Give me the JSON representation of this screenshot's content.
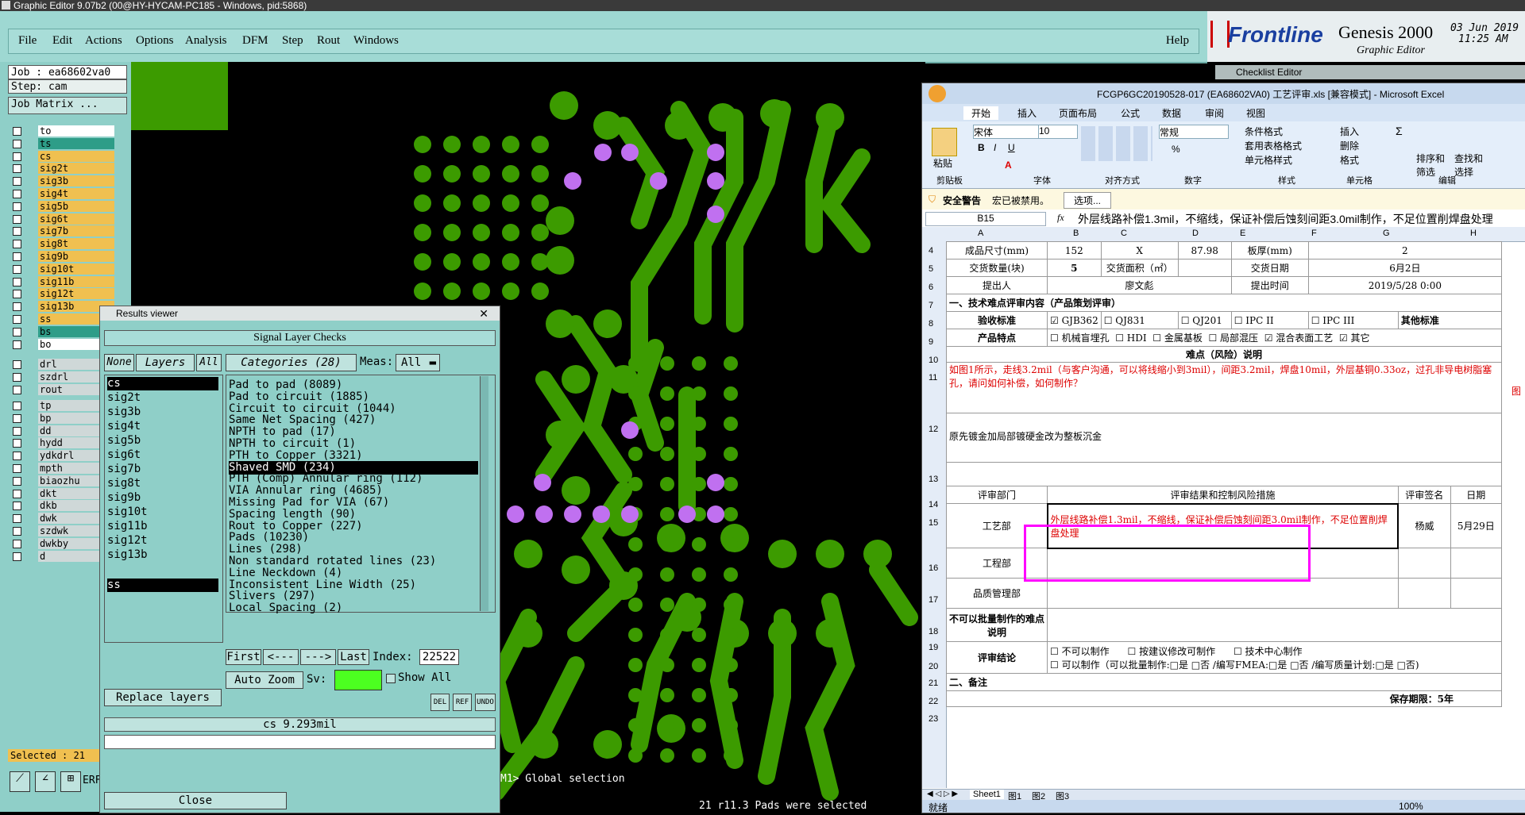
{
  "window_title": "Graphic Editor 9.07b2 (00@HY-HYCAM-PC185 - Windows, pid:5868)",
  "menu": [
    "File",
    "Edit",
    "Actions",
    "Options",
    "Analysis",
    "DFM",
    "Step",
    "Rout",
    "Windows"
  ],
  "help": "Help",
  "brand": {
    "logo": "Frontline",
    "product": "Genesis 2000",
    "subtitle": "Graphic Editor",
    "date": "03 Jun 2019",
    "time": "11:25 AM"
  },
  "job": {
    "job": "Job : ea68602va0",
    "step": "Step: cam",
    "matrix": "Job Matrix ..."
  },
  "layers_top": [
    {
      "name": "to",
      "color": "white"
    },
    {
      "name": "ts",
      "color": "teal"
    },
    {
      "name": "cs",
      "color": "yellow"
    },
    {
      "name": "sig2t",
      "color": "yellow"
    },
    {
      "name": "sig3b",
      "color": "yellow"
    },
    {
      "name": "sig4t",
      "color": "yellow"
    },
    {
      "name": "sig5b",
      "color": "yellow"
    },
    {
      "name": "sig6t",
      "color": "yellow"
    },
    {
      "name": "sig7b",
      "color": "yellow"
    },
    {
      "name": "sig8t",
      "color": "yellow"
    },
    {
      "name": "sig9b",
      "color": "yellow"
    },
    {
      "name": "sig10t",
      "color": "yellow"
    },
    {
      "name": "sig11b",
      "color": "yellow"
    },
    {
      "name": "sig12t",
      "color": "yellow"
    },
    {
      "name": "sig13b",
      "color": "yellow"
    },
    {
      "name": "ss",
      "color": "yellow"
    },
    {
      "name": "bs",
      "color": "teal"
    },
    {
      "name": "bo",
      "color": "white"
    }
  ],
  "layers_mid": [
    "drl",
    "szdrl",
    "rout"
  ],
  "layers_bot": [
    "tp",
    "bp",
    "dd",
    "hydd",
    "ydkdrl",
    "mpth",
    "biaozhu",
    "dkt",
    "dkb",
    "dwk",
    "szdwk",
    "dwkby",
    "d"
  ],
  "selected_count": "Selected : 21",
  "erf_prompt": "ERF-->",
  "results_viewer": {
    "title": "Results viewer",
    "heading": "Signal Layer Checks",
    "none": "None",
    "layers": "Layers",
    "all": "All",
    "categories": "Categories (28)",
    "meas_label": "Meas:",
    "meas_value": "All",
    "layer_list": [
      "cs",
      "sig2t",
      "sig3b",
      "sig4t",
      "sig5b",
      "sig6t",
      "sig7b",
      "sig8t",
      "sig9b",
      "sig10t",
      "sig11b",
      "sig12t",
      "sig13b",
      "ss"
    ],
    "category_list": [
      "Pad to pad (8089)",
      "Pad to circuit (1885)",
      "Circuit to circuit (1044)",
      "Same Net Spacing (427)",
      "NPTH to pad (17)",
      "NPTH to circuit (1)",
      "PTH to Copper (3321)",
      "Shaved SMD (234)",
      "PTH (Comp) Annular ring (112)",
      "VIA Annular ring (4685)",
      "Missing Pad for VIA (67)",
      "Spacing length (90)",
      "Rout to Copper (227)",
      "Pads (10230)",
      "Lines (298)",
      "Non standard rotated lines (23)",
      "Line Neckdown (4)",
      "Inconsistent Line Width (25)",
      "Slivers (297)",
      "Local Spacing (2)"
    ],
    "selected_category": "Shaved SMD (234)",
    "first": "First",
    "prev": "<---",
    "next": "--->",
    "last": "Last",
    "index_label": "Index:",
    "index_value": "22522",
    "auto_zoom": "Auto Zoom",
    "sv": "Sv:",
    "show_all": "Show All",
    "replace_layers": "Replace layers",
    "del": "DEL",
    "ref": "REF",
    "undo": "UNDO",
    "measure": "cs 9.293mil",
    "close": "Close"
  },
  "status": {
    "global": "M1> Global selection",
    "pads": "21 r11.3 Pads were selected"
  },
  "checklist": "Checklist Editor",
  "excel": {
    "title": "FCGP6GC20190528-017 (EA68602VA0) 工艺评审.xls [兼容模式] - Microsoft Excel",
    "tabs": [
      "开始",
      "插入",
      "页面布局",
      "公式",
      "数据",
      "审阅",
      "视图"
    ],
    "font": "宋体",
    "size": "10",
    "numfmt": "常规",
    "groups": [
      "剪贴板",
      "字体",
      "对齐方式",
      "数字",
      "样式",
      "单元格",
      "编辑"
    ],
    "ribbon_btns": [
      "粘贴",
      "条件格式",
      "套用表格格式",
      "单元格样式",
      "插入",
      "删除",
      "格式",
      "排序和筛选",
      "查找和选择"
    ],
    "security_title": "安全警告",
    "security_msg": "宏已被禁用。",
    "security_btn": "选项...",
    "cell_ref": "B15",
    "formula": "外层线路补偿1.3mil，不缩线，保证补偿后蚀刻间距3.0mil制作，不足位置削焊盘处理",
    "cols": [
      "A",
      "B",
      "C",
      "D",
      "E",
      "F",
      "G",
      "H"
    ],
    "rows": {
      "r4": [
        "成品尺寸(mm)",
        "152",
        "X",
        "87.98",
        "板厚(mm)",
        "2"
      ],
      "r5": [
        "交货数量(块)",
        "5",
        "交货面积（㎡）",
        "",
        "交货日期",
        "6月2日"
      ],
      "r6": [
        "提出人",
        "廖文彪",
        "提出时间",
        "2019/5/28 0:00"
      ],
      "r7": "一、技术难点评审内容（产品策划评审）",
      "r8": [
        "验收标准",
        "GJB362",
        "QJ831",
        "QJ201",
        "IPC II",
        "IPC III",
        "其他标准"
      ],
      "r9": [
        "产品特点",
        "机械盲埋孔",
        "HDI",
        "金属基板",
        "局部混压",
        "混合表面工艺",
        "其它"
      ],
      "r10": "难点（风险）说明",
      "r11": "如图1所示，走线3.2mil（与客户沟通，可以将线缩小到3mil），间距3.2mil，焊盘10mil，外层基铜0.33oz，过孔非导电树脂塞孔，请问如何补偿，如何制作？",
      "r11_note": "图",
      "r12": "原先镀金加局部镀硬金改为整板沉金",
      "r14": [
        "评审部门",
        "评审结果和控制风险措施",
        "评审签名",
        "日期"
      ],
      "r15": [
        "工艺部",
        "外层线路补偿1.3mil，不缩线，保证补偿后蚀刻间距3.0mil制作，不足位置削焊盘处理",
        "杨威",
        "5月29日"
      ],
      "r16": "工程部",
      "r17": "品质管理部",
      "r18": "不可以批量制作的难点说明",
      "r20": [
        "评审结论",
        "不可以制作",
        "按建议修改可制作",
        "技术中心制作"
      ],
      "r21": "可以制作（可以批量制作:□是 □否 /编写FMEA:□是 □否 /编写质量计划:□是 □否)",
      "r22": "二、备注",
      "r23": "保存期限：5年",
      "row_nums": [
        "4",
        "5",
        "6",
        "7",
        "8",
        "9",
        "10",
        "11",
        "12",
        "13",
        "14",
        "15",
        "16",
        "17",
        "18",
        "19",
        "20",
        "21",
        "22",
        "23"
      ],
      "sheets": [
        "Sheet1",
        "图1",
        "图2",
        "图3"
      ],
      "ready": "就绪",
      "zoom": "100%"
    }
  },
  "colors": {
    "teal": "#8fcfc8",
    "pcb_green": "#3c9b00",
    "pad_violet": "#c070f0",
    "highlight": "#ff00ff"
  }
}
